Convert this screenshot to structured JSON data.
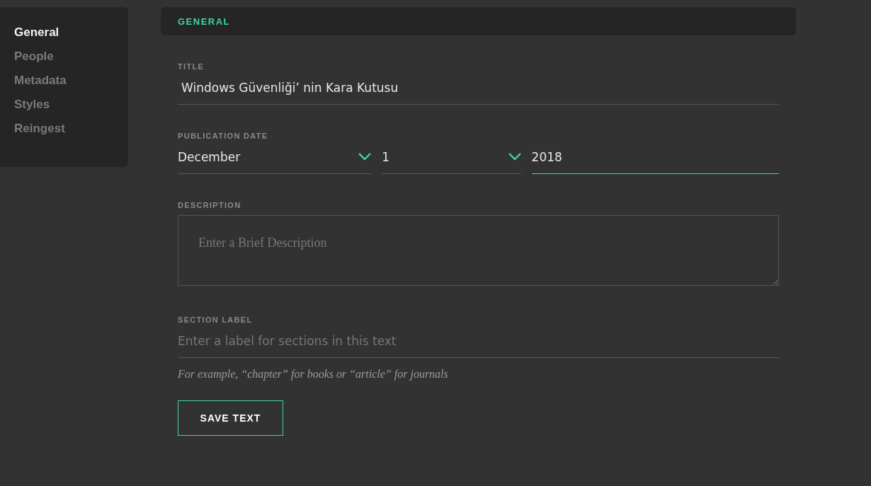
{
  "sidebar": {
    "items": [
      {
        "label": "General",
        "selected": true
      },
      {
        "label": "People",
        "selected": false
      },
      {
        "label": "Metadata",
        "selected": false
      },
      {
        "label": "Styles",
        "selected": false
      },
      {
        "label": "Reingest",
        "selected": false
      }
    ]
  },
  "header": {
    "title": "GENERAL"
  },
  "form": {
    "title": {
      "label": "TITLE",
      "value": "Windows Güvenliği’ nin Kara Kutusu"
    },
    "publication_date": {
      "label": "PUBLICATION DATE",
      "fields": [
        {
          "kind": "select",
          "value": "December",
          "focused": false
        },
        {
          "kind": "select",
          "value": "1",
          "focused": false
        },
        {
          "kind": "input",
          "value": "2018",
          "focused": true
        }
      ]
    },
    "description": {
      "label": "DESCRIPTION",
      "placeholder": "Enter a Brief Description"
    },
    "section_label": {
      "label": "SECTION LABEL",
      "placeholder": "Enter a label for sections in this text",
      "hint": "For example, “chapter” for books or “article” for journals"
    },
    "save_button": "SAVE TEXT"
  }
}
